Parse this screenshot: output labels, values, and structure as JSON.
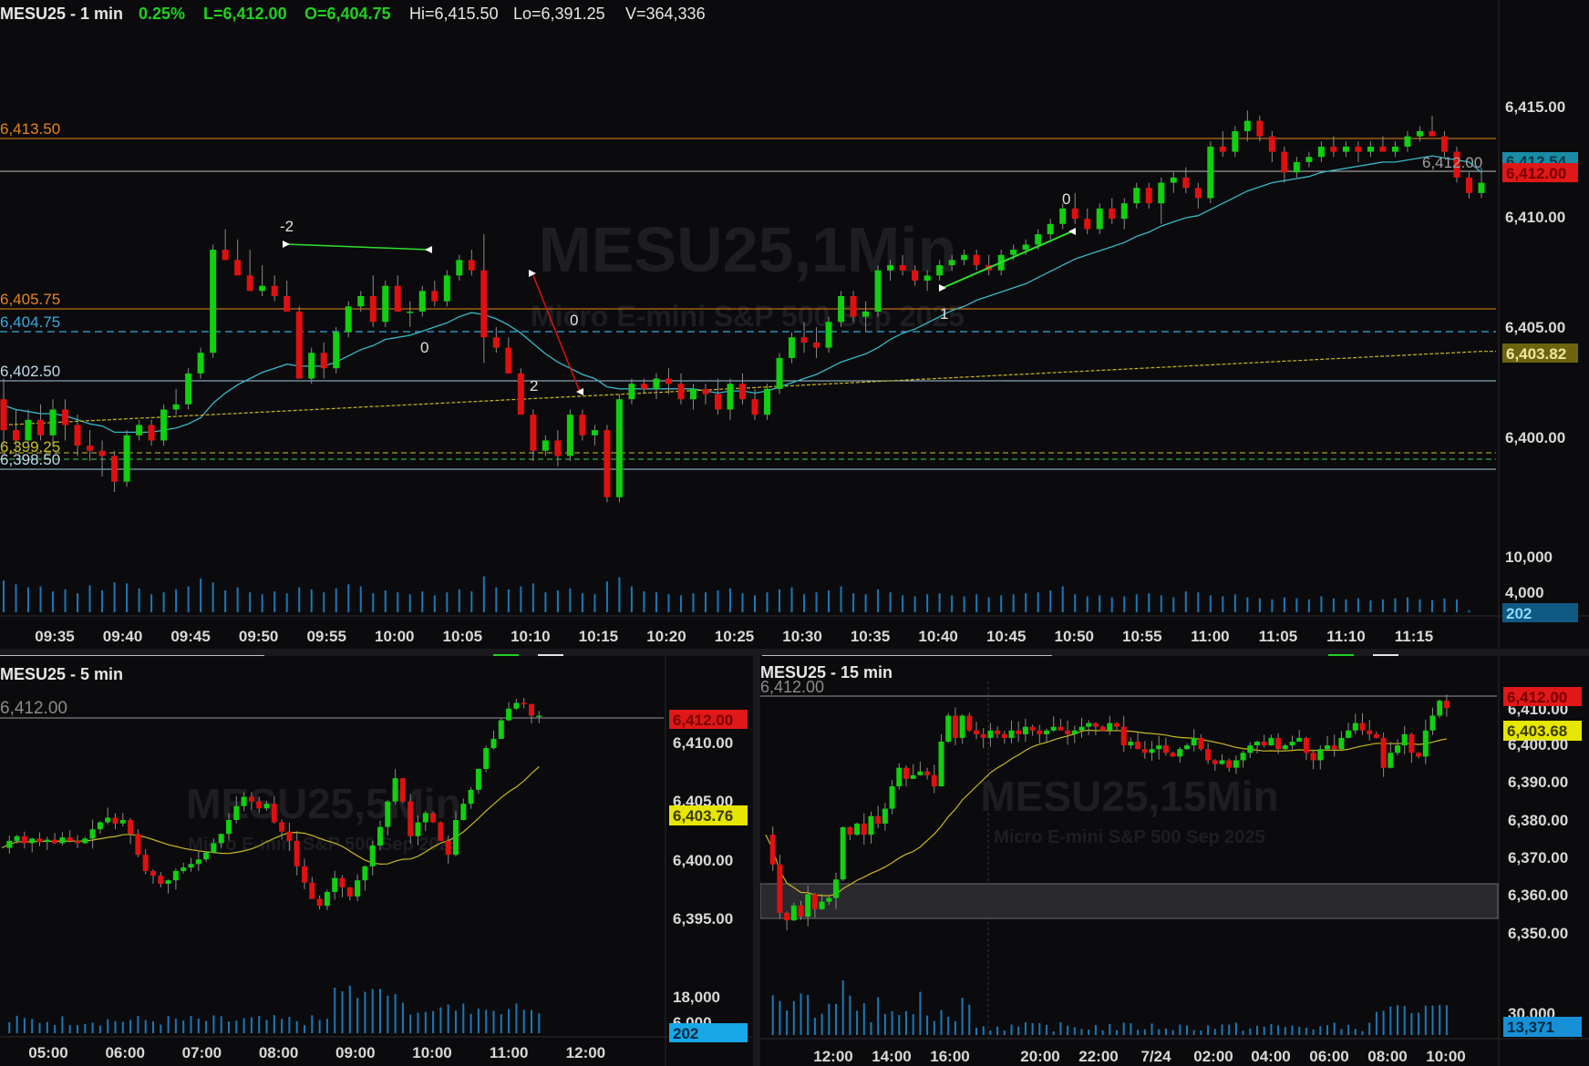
{
  "top": {
    "header": {
      "symbol": "MESU25 - 1 min",
      "change": "0.25%",
      "last": "L=6,412.00",
      "open": "O=6,404.75",
      "high": "Hi=6,415.50",
      "low": "Lo=6,391.25",
      "volume": "V=364,336"
    },
    "watermark": "MESU25,1Min",
    "watermark_sub": "Micro E-mini S&P 500 Sep 2025",
    "level_labels": [
      "6,413.50",
      "6,405.75",
      "6,404.75",
      "6,402.50",
      "6,399.25",
      "6,398.50"
    ],
    "price_ticks": [
      "6,415.00",
      "6,410.00",
      "6,405.00",
      "6,400.00"
    ],
    "price_tag_last": "6,412.00",
    "price_tag_ema": "6,412.54",
    "price_tag_sma": "6,403.82",
    "chart_last_label": "6,412.00",
    "volume_ticks": [
      "10,000",
      "4,000"
    ],
    "volume_tag": "202",
    "time_ticks": [
      "09:35",
      "09:40",
      "09:45",
      "09:50",
      "09:55",
      "10:00",
      "10:05",
      "10:10",
      "10:15",
      "10:20",
      "10:25",
      "10:30",
      "10:35",
      "10:40",
      "10:45",
      "10:50",
      "10:55",
      "11:00",
      "11:05",
      "11:10",
      "11:15"
    ],
    "swing_labels": [
      "-2",
      "0",
      "0",
      "2",
      "0",
      "1"
    ]
  },
  "bottom_left": {
    "symbol": "MESU25 - 5 min",
    "watermark": "MESU25,5Min",
    "watermark_sub": "Micro E-mini S&P 500 Sep 2025",
    "last_level": "6,412.00",
    "price_ticks": [
      "6,410.00",
      "6,405.00",
      "6,400.00",
      "6,395.00"
    ],
    "price_tag_last": "6,412.00",
    "price_tag_sma": "6,403.76",
    "volume_ticks": [
      "18,000",
      "6,000"
    ],
    "volume_tag": "202",
    "time_ticks": [
      "05:00",
      "06:00",
      "07:00",
      "08:00",
      "09:00",
      "10:00",
      "11:00",
      "12:00"
    ]
  },
  "bottom_right": {
    "symbol": "MESU25 - 15 min",
    "watermark": "MESU25,15Min",
    "watermark_sub": "Micro E-mini S&P 500 Sep 2025",
    "last_level": "6,412.00",
    "price_ticks": [
      "6,410.00",
      "6,400.00",
      "6,390.00",
      "6,380.00",
      "6,370.00",
      "6,360.00",
      "6,350.00"
    ],
    "price_tag_last": "6,412.00",
    "price_tag_sma": "6,403.68",
    "volume_ticks": [
      "30,000"
    ],
    "volume_tag": "13,371",
    "time_ticks": [
      "12:00",
      "14:00",
      "16:00",
      "20:00",
      "22:00",
      "7/24",
      "02:00",
      "04:00",
      "06:00",
      "08:00",
      "10:00"
    ]
  },
  "colors": {
    "up": "#10d010",
    "down": "#e01010",
    "background": "#0b0b0d",
    "ema": "#3ab8c8",
    "sma": "#c8b820",
    "level_orange": "#e8841c",
    "level_blue": "#3aa8e0",
    "tag_red": "#e01818",
    "tag_yellow": "#e6e600",
    "tag_blue": "#1890d8"
  },
  "chart_data": [
    {
      "type": "candlestick",
      "title": "MESU25 - 1 min",
      "ylim": [
        6397,
        6416
      ],
      "ohlc": [
        [
          6401.5,
          6402.5,
          6399.25,
          6400.0
        ],
        [
          6400.0,
          6401.0,
          6398.75,
          6399.5
        ],
        [
          6399.5,
          6401.0,
          6399.0,
          6400.5
        ],
        [
          6400.5,
          6401.25,
          6399.5,
          6399.75
        ],
        [
          6399.75,
          6401.5,
          6399.25,
          6401.0
        ],
        [
          6401.0,
          6401.5,
          6399.5,
          6400.25
        ],
        [
          6400.25,
          6400.75,
          6398.75,
          6399.25
        ],
        [
          6399.25,
          6400.0,
          6398.5,
          6399.0
        ],
        [
          6399.0,
          6399.5,
          6397.75,
          6398.75
        ],
        [
          6398.75,
          6399.0,
          6397.0,
          6397.5
        ],
        [
          6397.5,
          6400.0,
          6397.25,
          6399.75
        ],
        [
          6399.75,
          6400.5,
          6399.5,
          6400.25
        ],
        [
          6400.25,
          6400.5,
          6399.25,
          6399.5
        ],
        [
          6399.5,
          6401.25,
          6399.25,
          6401.0
        ],
        [
          6401.0,
          6402.0,
          6400.75,
          6401.25
        ],
        [
          6401.25,
          6403.0,
          6401.0,
          6402.75
        ],
        [
          6402.75,
          6404.0,
          6402.5,
          6403.75
        ],
        [
          6403.75,
          6409.0,
          6403.5,
          6408.75
        ],
        [
          6408.75,
          6409.75,
          6408.25,
          6408.25
        ],
        [
          6408.25,
          6409.25,
          6407.75,
          6407.5
        ],
        [
          6407.5,
          6408.75,
          6406.75,
          6406.75
        ],
        [
          6406.75,
          6408.0,
          6406.5,
          6407.0
        ],
        [
          6407.0,
          6407.5,
          6406.25,
          6406.5
        ],
        [
          6406.5,
          6407.25,
          6405.75,
          6405.75
        ],
        [
          6405.75,
          6406.0,
          6402.5,
          6402.5
        ],
        [
          6402.5,
          6404.0,
          6402.25,
          6403.75
        ],
        [
          6403.75,
          6404.25,
          6402.5,
          6403.0
        ],
        [
          6403.0,
          6405.0,
          6402.75,
          6404.75
        ],
        [
          6404.75,
          6406.25,
          6404.5,
          6406.0
        ],
        [
          6406.0,
          6406.75,
          6405.75,
          6406.5
        ],
        [
          6406.5,
          6407.5,
          6405.0,
          6405.25
        ],
        [
          6405.25,
          6407.25,
          6405.0,
          6407.0
        ],
        [
          6407.0,
          6407.5,
          6405.75,
          6405.75
        ],
        [
          6405.75,
          6406.25,
          6405.0,
          6405.75
        ],
        [
          6405.75,
          6407.0,
          6405.5,
          6406.75
        ],
        [
          6406.75,
          6407.25,
          6406.0,
          6406.25
        ],
        [
          6406.25,
          6407.75,
          6406.0,
          6407.5
        ],
        [
          6407.5,
          6408.5,
          6407.25,
          6408.25
        ],
        [
          6408.25,
          6408.75,
          6407.5,
          6407.75
        ],
        [
          6407.75,
          6409.5,
          6403.25,
          6404.5
        ],
        [
          6404.5,
          6405.0,
          6403.75,
          6404.0
        ],
        [
          6404.0,
          6404.5,
          6402.75,
          6402.75
        ],
        [
          6402.75,
          6403.0,
          6400.75,
          6400.75
        ],
        [
          6400.75,
          6401.0,
          6398.5,
          6399.0
        ],
        [
          6399.0,
          6399.75,
          6398.75,
          6399.5
        ],
        [
          6399.5,
          6400.0,
          6398.25,
          6398.75
        ],
        [
          6398.75,
          6401.0,
          6398.5,
          6400.75
        ],
        [
          6400.75,
          6401.0,
          6399.5,
          6399.75
        ],
        [
          6399.75,
          6400.25,
          6399.25,
          6400.0
        ],
        [
          6400.0,
          6400.25,
          6396.5,
          6396.75
        ],
        [
          6396.75,
          6401.75,
          6396.5,
          6401.5
        ],
        [
          6401.5,
          6402.5,
          6401.25,
          6402.25
        ],
        [
          6402.25,
          6402.5,
          6401.75,
          6402.0
        ],
        [
          6402.0,
          6402.75,
          6401.5,
          6402.5
        ],
        [
          6402.5,
          6403.0,
          6401.75,
          6402.25
        ],
        [
          6402.25,
          6402.75,
          6401.25,
          6401.5
        ],
        [
          6401.5,
          6402.25,
          6401.0,
          6402.0
        ],
        [
          6402.0,
          6402.25,
          6401.25,
          6401.75
        ],
        [
          6401.75,
          6402.5,
          6400.75,
          6401.0
        ],
        [
          6401.0,
          6402.5,
          6400.5,
          6402.25
        ],
        [
          6402.25,
          6402.75,
          6401.25,
          6401.5
        ],
        [
          6401.5,
          6402.0,
          6400.5,
          6400.75
        ],
        [
          6400.75,
          6402.25,
          6400.5,
          6402.0
        ],
        [
          6402.0,
          6403.75,
          6401.75,
          6403.5
        ],
        [
          6403.5,
          6404.75,
          6403.25,
          6404.5
        ],
        [
          6404.5,
          6405.25,
          6403.75,
          6404.25
        ],
        [
          6404.25,
          6405.0,
          6403.5,
          6404.0
        ],
        [
          6404.0,
          6405.5,
          6403.75,
          6405.25
        ],
        [
          6405.25,
          6406.75,
          6405.0,
          6406.5
        ],
        [
          6406.5,
          6406.75,
          6405.25,
          6405.5
        ],
        [
          6405.5,
          6406.25,
          6404.75,
          6405.75
        ],
        [
          6405.75,
          6408.0,
          6405.5,
          6407.75
        ],
        [
          6407.75,
          6408.25,
          6407.25,
          6408.0
        ],
        [
          6408.0,
          6408.5,
          6407.5,
          6407.75
        ],
        [
          6407.75,
          6408.0,
          6407.0,
          6407.25
        ],
        [
          6407.25,
          6407.75,
          6406.75,
          6407.5
        ],
        [
          6407.5,
          6408.25,
          6407.25,
          6408.0
        ],
        [
          6408.0,
          6408.5,
          6407.75,
          6408.25
        ],
        [
          6408.25,
          6408.75,
          6408.0,
          6408.5
        ],
        [
          6408.5,
          6408.75,
          6407.75,
          6408.0
        ],
        [
          6408.0,
          6408.5,
          6407.5,
          6407.75
        ],
        [
          6407.75,
          6408.75,
          6407.5,
          6408.5
        ],
        [
          6408.5,
          6409.0,
          6408.25,
          6408.75
        ],
        [
          6408.75,
          6409.25,
          6408.5,
          6409.0
        ],
        [
          6409.0,
          6409.75,
          6408.75,
          6409.5
        ],
        [
          6409.5,
          6410.25,
          6409.25,
          6410.0
        ],
        [
          6410.0,
          6411.0,
          6409.75,
          6410.75
        ],
        [
          6410.75,
          6411.5,
          6410.0,
          6410.25
        ],
        [
          6410.25,
          6410.75,
          6409.5,
          6409.75
        ],
        [
          6409.75,
          6411.0,
          6409.5,
          6410.75
        ],
        [
          6410.75,
          6411.25,
          6410.0,
          6410.25
        ],
        [
          6410.25,
          6411.25,
          6409.75,
          6411.0
        ],
        [
          6411.0,
          6412.0,
          6410.75,
          6411.75
        ],
        [
          6411.75,
          6412.0,
          6410.75,
          6411.0
        ],
        [
          6411.0,
          6412.25,
          6410.0,
          6412.0
        ],
        [
          6412.0,
          6412.5,
          6411.5,
          6412.25
        ],
        [
          6412.25,
          6412.75,
          6411.5,
          6411.75
        ],
        [
          6411.75,
          6412.0,
          6410.75,
          6411.25
        ],
        [
          6411.25,
          6414.0,
          6411.0,
          6413.75
        ],
        [
          6413.75,
          6414.5,
          6413.25,
          6413.5
        ],
        [
          6413.5,
          6414.75,
          6413.25,
          6414.5
        ],
        [
          6414.5,
          6415.5,
          6414.0,
          6415.0
        ],
        [
          6415.0,
          6415.25,
          6414.0,
          6414.25
        ],
        [
          6414.25,
          6414.5,
          6413.0,
          6413.5
        ],
        [
          6413.5,
          6413.75,
          6412.0,
          6412.5
        ],
        [
          6412.5,
          6413.25,
          6412.25,
          6413.0
        ],
        [
          6413.0,
          6413.5,
          6412.75,
          6413.25
        ],
        [
          6413.25,
          6414.0,
          6413.0,
          6413.75
        ],
        [
          6413.75,
          6414.25,
          6413.25,
          6413.5
        ],
        [
          6413.5,
          6414.0,
          6413.25,
          6413.75
        ],
        [
          6413.75,
          6414.0,
          6413.0,
          6413.5
        ],
        [
          6413.5,
          6414.0,
          6413.25,
          6413.75
        ],
        [
          6413.75,
          6414.25,
          6413.5,
          6413.5
        ],
        [
          6413.5,
          6414.0,
          6413.25,
          6413.75
        ],
        [
          6413.75,
          6414.5,
          6413.5,
          6414.25
        ],
        [
          6414.25,
          6414.75,
          6414.0,
          6414.5
        ],
        [
          6414.5,
          6415.25,
          6414.25,
          6414.25
        ],
        [
          6414.25,
          6414.5,
          6413.25,
          6413.5
        ],
        [
          6413.5,
          6413.75,
          6412.0,
          6412.25
        ],
        [
          6412.25,
          6412.5,
          6411.25,
          6411.5
        ],
        [
          6411.5,
          6412.75,
          6411.25,
          6412.0
        ]
      ],
      "volume_ylim": [
        0,
        12000
      ],
      "volume": [
        3200,
        2800,
        2500,
        2600,
        2100,
        2300,
        1900,
        2700,
        2200,
        3000,
        2900,
        2400,
        1800,
        2000,
        2300,
        2600,
        3400,
        3000,
        2200,
        2500,
        2000,
        1800,
        2100,
        1900,
        2500,
        2300,
        2000,
        2400,
        2800,
        2600,
        1900,
        2200,
        2000,
        1800,
        2100,
        1700,
        2000,
        2300,
        2100,
        3600,
        2500,
        2300,
        2600,
        2900,
        2000,
        2200,
        2400,
        1900,
        1800,
        3100,
        3500,
        2600,
        2100,
        2000,
        1800,
        1700,
        1900,
        2000,
        2200,
        2400,
        1900,
        1700,
        2000,
        2300,
        2500,
        1800,
        2000,
        2200,
        2600,
        1900,
        1800,
        2300,
        2000,
        1700,
        1600,
        1800,
        1900,
        1700,
        1600,
        1800,
        1500,
        1700,
        1800,
        1900,
        2000,
        2200,
        2600,
        1800,
        1600,
        1700,
        1500,
        1600,
        1800,
        1900,
        1700,
        1500,
        2100,
        2000,
        1700,
        1600,
        1800,
        1500,
        1400,
        1300,
        1500,
        1400,
        1300,
        1600,
        1400,
        1300,
        1400,
        1200,
        1300,
        1400,
        1500,
        1300,
        1200,
        1400,
        1300,
        202
      ],
      "ema": [
        6401.2,
        6401.0,
        6400.9,
        6400.8,
        6400.8,
        6400.7,
        6400.5,
        6400.3,
        6400.2,
        6399.9,
        6399.9,
        6399.9,
        6399.9,
        6400.0,
        6400.1,
        6400.3,
        6400.6,
        6401.3,
        6401.8,
        6402.2,
        6402.5,
        6402.8,
        6403.0,
        6403.2,
        6403.1,
        6403.1,
        6403.1,
        6403.3,
        6403.6,
        6403.9,
        6404.1,
        6404.4,
        6404.5,
        6404.6,
        6404.8,
        6405.0,
        6405.2,
        6405.5,
        6405.7,
        6405.6,
        6405.4,
        6405.1,
        6404.7,
        6404.2,
        6403.7,
        6403.3,
        6403.0,
        6402.7,
        6402.5,
        6402.1,
        6402.0,
        6402.0,
        6402.0,
        6402.0,
        6402.0,
        6402.0,
        6402.0,
        6401.9,
        6401.8,
        6401.9,
        6401.9,
        6401.8,
        6401.9,
        6402.1,
        6402.3,
        6402.5,
        6402.7,
        6403.0,
        6403.3,
        6403.5,
        6403.7,
        6404.0,
        6404.4,
        6404.7,
        6404.9,
        6405.2,
        6405.5,
        6405.8,
        6406.0,
        6406.3,
        6406.5,
        6406.7,
        6406.9,
        6407.1,
        6407.4,
        6407.7,
        6408.0,
        6408.3,
        6408.5,
        6408.7,
        6408.9,
        6409.1,
        6409.4,
        6409.6,
        6409.9,
        6410.1,
        6410.3,
        6410.4,
        6410.7,
        6411.0,
        6411.3,
        6411.6,
        6411.8,
        6412.0,
        6412.1,
        6412.2,
        6412.3,
        6412.5,
        6412.6,
        6412.7,
        6412.8,
        6412.9,
        6413.0,
        6413.0,
        6413.1,
        6413.2,
        6413.3,
        6413.2,
        6413.1,
        6413.0,
        6412.5
      ]
    },
    {
      "type": "candlestick",
      "title": "MESU25 - 5 min",
      "ylim": [
        6392,
        6414
      ]
    },
    {
      "type": "candlestick",
      "title": "MESU25 - 15 min",
      "ylim": [
        6345,
        6415
      ]
    }
  ]
}
